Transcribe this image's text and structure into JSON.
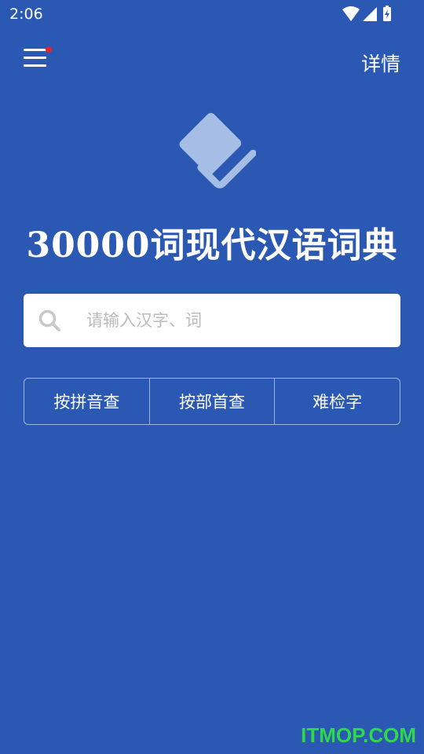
{
  "status_bar": {
    "time": "2:06",
    "icons": [
      "wifi-icon",
      "cell-signal-icon",
      "battery-charging-icon"
    ]
  },
  "header": {
    "menu_icon": "menu-icon",
    "details_label": "详情"
  },
  "logo": {
    "icon": "book-icon"
  },
  "title": "30000词现代汉语词典",
  "search": {
    "icon": "search-icon",
    "placeholder": "请输入汉字、词",
    "value": ""
  },
  "search_modes": [
    {
      "label": "按拼音查"
    },
    {
      "label": "按部首查"
    },
    {
      "label": "难检字"
    }
  ],
  "watermark": "ITMOP.COM",
  "colors": {
    "background": "#2b58b3",
    "badge": "#e8202a",
    "watermark": "#2fd84a"
  }
}
